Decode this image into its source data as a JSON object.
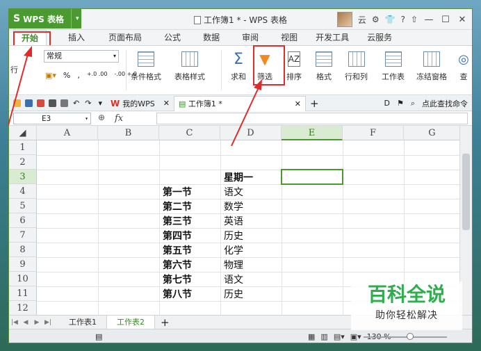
{
  "app": {
    "name": "WPS 表格",
    "window_title": "工作簿1 * - WPS 表格",
    "user": "云"
  },
  "window_controls": {
    "help": "?",
    "minimize": "—",
    "maximize": "☐",
    "close": "✕"
  },
  "ribbon_tabs": [
    "开始",
    "插入",
    "页面布局",
    "公式",
    "数据",
    "审阅",
    "视图",
    "开发工具",
    "云服务"
  ],
  "ribbon": {
    "number_format": "常规",
    "percent": "%",
    "thousands": "‚",
    "dec_inc": "+.0 .00",
    "dec_dec": "-.00 +.0",
    "wrap": "行",
    "buttons": {
      "cond_format": "条件格式",
      "table_style": "表格样式",
      "sum": "求和",
      "filter": "筛选",
      "sort": "排序",
      "format": "格式",
      "rows_cols": "行和列",
      "worksheet": "工作表",
      "freeze": "冻结窗格",
      "find": "查"
    }
  },
  "doc_tabs": {
    "mywps": "我的WPS",
    "current": "工作簿1 *",
    "add": "+",
    "search": "点此查找命令"
  },
  "formula_bar": {
    "cell_ref": "E3",
    "fx": "fx",
    "value": ""
  },
  "grid": {
    "columns": [
      "A",
      "B",
      "C",
      "D",
      "E",
      "F",
      "G"
    ],
    "selected_column": "E",
    "rows": [
      "1",
      "2",
      "3",
      "4",
      "5",
      "6",
      "7",
      "8",
      "9",
      "10",
      "11",
      "12"
    ],
    "selected_row": "3",
    "header_cell": "星期一",
    "schedule": [
      {
        "period": "第一节",
        "subject": "语文"
      },
      {
        "period": "第二节",
        "subject": "数学"
      },
      {
        "period": "第三节",
        "subject": "英语"
      },
      {
        "period": "第四节",
        "subject": "历史"
      },
      {
        "period": "第五节",
        "subject": "化学"
      },
      {
        "period": "第六节",
        "subject": "物理"
      },
      {
        "period": "第七节",
        "subject": "语文"
      },
      {
        "period": "第八节",
        "subject": "历史"
      }
    ]
  },
  "sheets": [
    "工作表1",
    "工作表2"
  ],
  "active_sheet": "工作表2",
  "status": {
    "zoom": "130 %"
  },
  "watermark": {
    "title": "百科全说",
    "subtitle": "助你轻松解决"
  },
  "colors": {
    "accent": "#4a9b2f",
    "highlight": "#e02b2b"
  }
}
